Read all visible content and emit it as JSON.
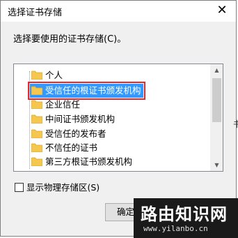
{
  "dialog": {
    "title": "选择证书存储",
    "close_glyph": "✕",
    "prompt": "选择要使用的证书存储(C)。"
  },
  "tree": {
    "items": [
      {
        "label": "个人",
        "selected": false
      },
      {
        "label": "受信任的根证书颁发机构",
        "selected": true
      },
      {
        "label": "企业信任",
        "selected": false
      },
      {
        "label": "中间证书颁发机构",
        "selected": false
      },
      {
        "label": "受信任的发布者",
        "selected": false
      },
      {
        "label": "不信任的证书",
        "selected": false
      },
      {
        "label": "第三方根证书颁发机构",
        "selected": false
      }
    ],
    "scroll_up_glyph": "▲",
    "scroll_down_glyph": "▼"
  },
  "checkbox": {
    "label": "显示物理存储区(S)",
    "checked": false
  },
  "buttons": {
    "ok_label": "确定"
  },
  "side_glyph": "书",
  "watermark": {
    "title": "路由知识网",
    "url": "www.yilanbo.cn"
  },
  "colors": {
    "selection_bg": "#3399ff",
    "highlight_box": "#e8262c",
    "folder": "#f5c74e"
  }
}
